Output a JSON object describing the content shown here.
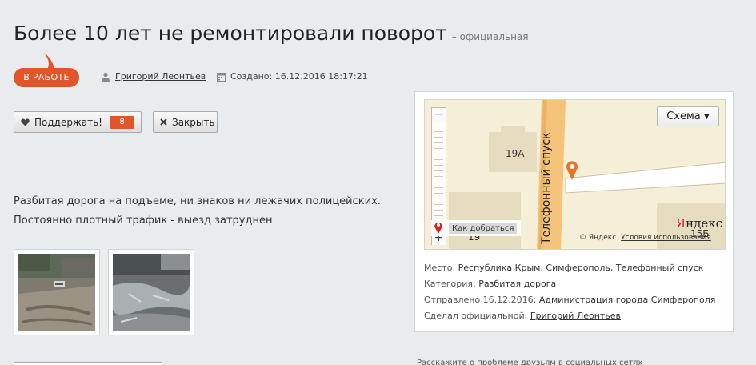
{
  "page": {
    "title": "Более 10 лет не ремонтировали поворот",
    "subtitle": "– официальная"
  },
  "status": {
    "label": "В РАБОТЕ",
    "color": "#e2552a"
  },
  "meta": {
    "author": "Григорий Леонтьев",
    "created": "Создано: 16.12.2016 18:17:21"
  },
  "actions": {
    "support_label": "Поддержать!",
    "support_count": "8",
    "close_label": "Закрыть"
  },
  "description": {
    "line1": "Разбитая дорога на подъеме, ни знаков ни лежачих полицейских.",
    "line2": "Постоянно плотный трафик - выезд затруднен"
  },
  "map": {
    "scheme_label": "Схема",
    "label_19a": "19А",
    "label_19": "19",
    "label_15": "15Б",
    "street": "Телефонный спуск",
    "route_label": "Как добраться",
    "copyright": "© Яндекс",
    "terms": "Условия использования",
    "logo_y": "Я",
    "logo_rest": "ндекс"
  },
  "info": {
    "place_key": "Место:",
    "place_val": "Республика Крым, Симферополь, Телефонный спуск",
    "category_key": "Категория:",
    "category_val": "Разбитая дорога",
    "sent_key": "Отправлено 16.12.2016:",
    "sent_val": "Администрация города Симферополя",
    "official_key": "Сделал официальной:",
    "official_val": "Григорий Леонтьев"
  },
  "share": {
    "text": "Расскажите о проблеме друзьям в социальных сетях"
  }
}
